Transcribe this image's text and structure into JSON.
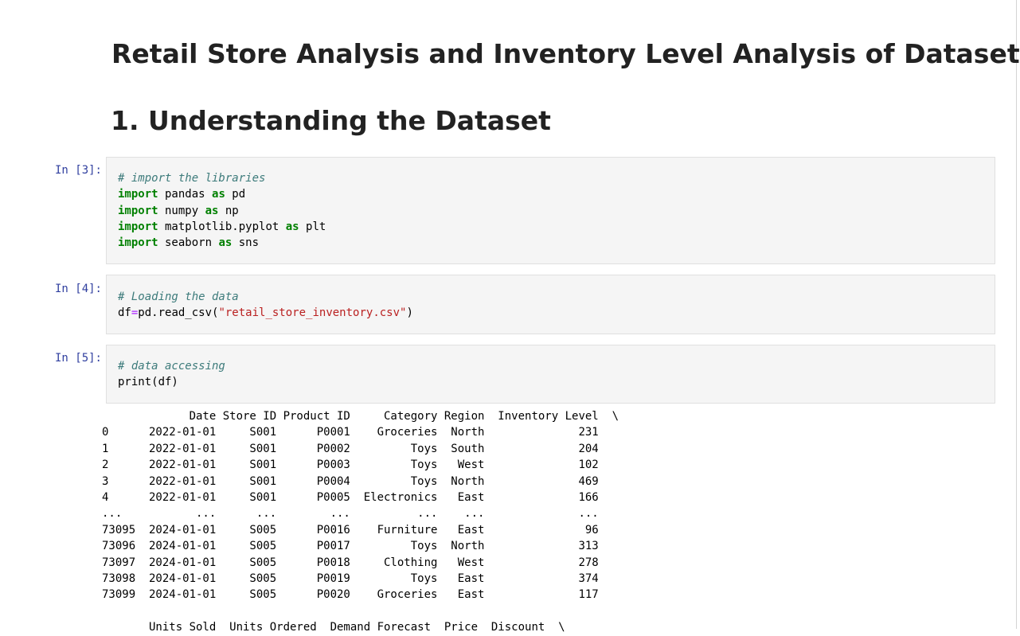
{
  "title": "Retail Store Analysis and Inventory Level Analysis of Dataset",
  "section_heading": "1. Understanding the Dataset",
  "cells": [
    {
      "prompt": "In [3]:",
      "lines": [
        [
          {
            "t": "c",
            "v": "# import the libraries"
          }
        ],
        [
          {
            "t": "k",
            "v": "import"
          },
          {
            "t": "n",
            "v": " pandas "
          },
          {
            "t": "k",
            "v": "as"
          },
          {
            "t": "n",
            "v": " pd"
          }
        ],
        [
          {
            "t": "k",
            "v": "import"
          },
          {
            "t": "n",
            "v": " numpy "
          },
          {
            "t": "k",
            "v": "as"
          },
          {
            "t": "n",
            "v": " np"
          }
        ],
        [
          {
            "t": "k",
            "v": "import"
          },
          {
            "t": "n",
            "v": " matplotlib.pyplot "
          },
          {
            "t": "k",
            "v": "as"
          },
          {
            "t": "n",
            "v": " plt"
          }
        ],
        [
          {
            "t": "k",
            "v": "import"
          },
          {
            "t": "n",
            "v": " seaborn "
          },
          {
            "t": "k",
            "v": "as"
          },
          {
            "t": "n",
            "v": " sns"
          }
        ]
      ]
    },
    {
      "prompt": "In [4]:",
      "lines": [
        [
          {
            "t": "c",
            "v": "# Loading the data"
          }
        ],
        [
          {
            "t": "n",
            "v": "df"
          },
          {
            "t": "o",
            "v": "="
          },
          {
            "t": "n",
            "v": "pd.read_csv("
          },
          {
            "t": "s",
            "v": "\"retail_store_inventory.csv\""
          },
          {
            "t": "n",
            "v": ")"
          }
        ]
      ]
    },
    {
      "prompt": "In [5]:",
      "lines": [
        [
          {
            "t": "c",
            "v": "# data accessing"
          }
        ],
        [
          {
            "t": "n",
            "v": "print(df)"
          }
        ]
      ]
    }
  ],
  "output": {
    "lines": [
      "             Date Store ID Product ID     Category Region  Inventory Level  \\",
      "0      2022-01-01     S001      P0001    Groceries  North              231   ",
      "1      2022-01-01     S001      P0002         Toys  South              204   ",
      "2      2022-01-01     S001      P0003         Toys   West              102   ",
      "3      2022-01-01     S001      P0004         Toys  North              469   ",
      "4      2022-01-01     S001      P0005  Electronics   East              166   ",
      "...           ...      ...        ...          ...    ...              ...   ",
      "73095  2024-01-01     S005      P0016    Furniture   East               96   ",
      "73096  2024-01-01     S005      P0017         Toys  North              313   ",
      "73097  2024-01-01     S005      P0018     Clothing   West              278   ",
      "73098  2024-01-01     S005      P0019         Toys   East              374   ",
      "73099  2024-01-01     S005      P0020    Groceries   East              117   ",
      "",
      "       Units Sold  Units Ordered  Demand Forecast  Price  Discount  \\"
    ]
  }
}
